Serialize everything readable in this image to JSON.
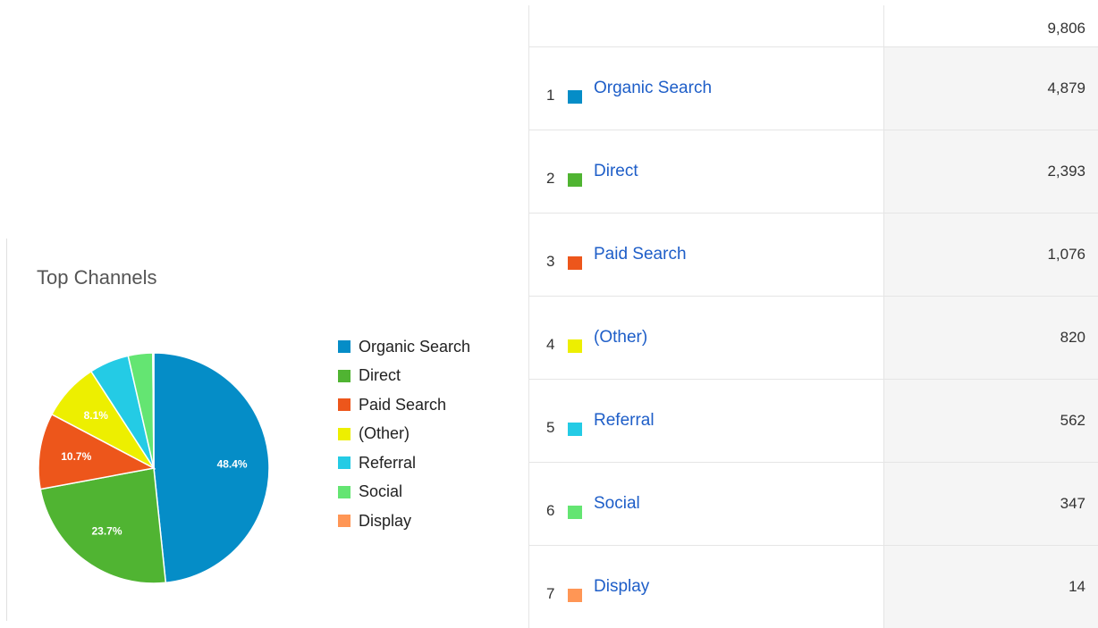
{
  "widget": {
    "title": "Top Channels"
  },
  "chart_data": {
    "type": "pie",
    "categories": [
      "Organic Search",
      "Direct",
      "Paid Search",
      "(Other)",
      "Referral",
      "Social",
      "Display"
    ],
    "values": [
      4879,
      2393,
      1076,
      820,
      562,
      347,
      14
    ],
    "labels": [
      "48.4%",
      "23.7%",
      "10.7%",
      "8.1%",
      "",
      "",
      ""
    ],
    "colors": [
      "#058dc7",
      "#50b432",
      "#ed561b",
      "#edef00",
      "#24cbe5",
      "#64e572",
      "#ff9655"
    ],
    "legend_position": "right"
  },
  "legend": [
    {
      "label": "Organic Search",
      "color": "#058dc7"
    },
    {
      "label": "Direct",
      "color": "#50b432"
    },
    {
      "label": "Paid Search",
      "color": "#ed561b"
    },
    {
      "label": "(Other)",
      "color": "#edef00"
    },
    {
      "label": "Referral",
      "color": "#24cbe5"
    },
    {
      "label": "Social",
      "color": "#64e572"
    },
    {
      "label": "Display",
      "color": "#ff9655"
    }
  ],
  "table": {
    "total": "9,806",
    "rows": [
      {
        "rank": "1",
        "channel": "Organic Search",
        "value": "4,879",
        "color": "#058dc7"
      },
      {
        "rank": "2",
        "channel": "Direct",
        "value": "2,393",
        "color": "#50b432"
      },
      {
        "rank": "3",
        "channel": "Paid Search",
        "value": "1,076",
        "color": "#ed561b"
      },
      {
        "rank": "4",
        "channel": "(Other)",
        "value": "820",
        "color": "#edef00"
      },
      {
        "rank": "5",
        "channel": "Referral",
        "value": "562",
        "color": "#24cbe5"
      },
      {
        "rank": "6",
        "channel": "Social",
        "value": "347",
        "color": "#64e572"
      },
      {
        "rank": "7",
        "channel": "Display",
        "value": "14",
        "color": "#ff9655"
      }
    ]
  }
}
